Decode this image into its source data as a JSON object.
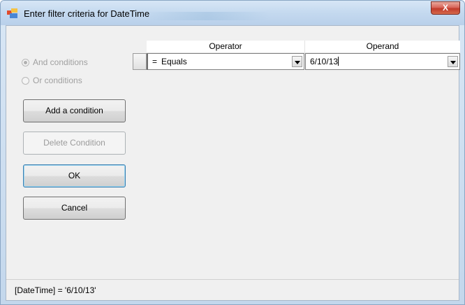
{
  "window": {
    "title": "Enter filter criteria for DateTime",
    "close_glyph": "X"
  },
  "conditions": {
    "and_label": "And conditions",
    "or_label": "Or conditions",
    "selected": "and"
  },
  "buttons": {
    "add": "Add a condition",
    "delete": "Delete Condition",
    "ok": "OK",
    "cancel": "Cancel"
  },
  "grid": {
    "headers": {
      "operator": "Operator",
      "operand": "Operand"
    },
    "rows": [
      {
        "operator_symbol": "=",
        "operator": "Equals",
        "operand": "6/10/13"
      }
    ]
  },
  "status": {
    "expression": "[DateTime] = '6/10/13'"
  },
  "colors": {
    "title_bar": "#c4d9ef",
    "close_button": "#c13b2b",
    "client_bg": "#f0f0f0"
  }
}
